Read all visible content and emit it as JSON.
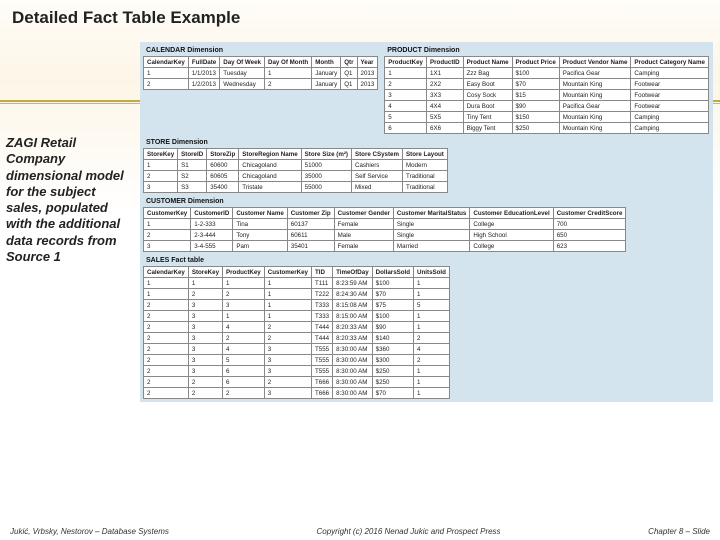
{
  "title": "Detailed Fact Table Example",
  "sidebar": "ZAGI Retail Company dimensional model for the subject sales, populated with the additional data records from Source 1",
  "calendar": {
    "title": "CALENDAR Dimension",
    "headers": [
      "CalendarKey",
      "FullDate",
      "Day Of Week",
      "Day Of Month",
      "Month",
      "Qtr",
      "Year"
    ],
    "rows": [
      [
        "1",
        "1/1/2013",
        "Tuesday",
        "1",
        "January",
        "Q1",
        "2013"
      ],
      [
        "2",
        "1/2/2013",
        "Wednesday",
        "2",
        "January",
        "Q1",
        "2013"
      ]
    ]
  },
  "product": {
    "title": "PRODUCT Dimension",
    "headers": [
      "ProductKey",
      "ProductID",
      "Product Name",
      "Product Price",
      "Product Vendor Name",
      "Product Category Name"
    ],
    "rows": [
      [
        "1",
        "1X1",
        "Zzz Bag",
        "$100",
        "Pacifica Gear",
        "Camping"
      ],
      [
        "2",
        "2X2",
        "Easy Boot",
        "$70",
        "Mountain King",
        "Footwear"
      ],
      [
        "3",
        "3X3",
        "Cosy Sock",
        "$15",
        "Mountain King",
        "Footwear"
      ],
      [
        "4",
        "4X4",
        "Dura Boot",
        "$90",
        "Pacifica Gear",
        "Footwear"
      ],
      [
        "5",
        "5X5",
        "Tiny Tent",
        "$150",
        "Mountain King",
        "Camping"
      ],
      [
        "6",
        "6X6",
        "Biggy Tent",
        "$250",
        "Mountain King",
        "Camping"
      ]
    ]
  },
  "store": {
    "title": "STORE Dimension",
    "headers": [
      "StoreKey",
      "StoreID",
      "StoreZip",
      "StoreRegion Name",
      "Store Size (m²)",
      "Store CSystem",
      "Store Layout"
    ],
    "rows": [
      [
        "1",
        "S1",
        "60600",
        "Chicagoland",
        "51000",
        "Cashiers",
        "Modern"
      ],
      [
        "2",
        "S2",
        "60605",
        "Chicagoland",
        "35000",
        "Self Service",
        "Traditional"
      ],
      [
        "3",
        "S3",
        "35400",
        "Tristate",
        "55000",
        "Mixed",
        "Traditional"
      ]
    ]
  },
  "customer": {
    "title": "CUSTOMER Dimension",
    "headers": [
      "CustomerKey",
      "CustomerID",
      "Customer Name",
      "Customer Zip",
      "Customer Gender",
      "Customer MaritalStatus",
      "Customer EducationLevel",
      "Customer CreditScore"
    ],
    "rows": [
      [
        "1",
        "1-2-333",
        "Tina",
        "60137",
        "Female",
        "Single",
        "College",
        "700"
      ],
      [
        "2",
        "2-3-444",
        "Tony",
        "60611",
        "Male",
        "Single",
        "High School",
        "650"
      ],
      [
        "3",
        "3-4-555",
        "Pam",
        "35401",
        "Female",
        "Married",
        "College",
        "623"
      ]
    ]
  },
  "sales": {
    "title": "SALES Fact table",
    "headers": [
      "CalendarKey",
      "StoreKey",
      "ProductKey",
      "CustomerKey",
      "TID",
      "TimeOfDay",
      "DollarsSold",
      "UnitsSold"
    ],
    "rows": [
      [
        "1",
        "1",
        "1",
        "1",
        "T111",
        "8:23:59 AM",
        "$100",
        "1"
      ],
      [
        "1",
        "2",
        "2",
        "1",
        "T222",
        "8:24:30 AM",
        "$70",
        "1"
      ],
      [
        "2",
        "3",
        "3",
        "1",
        "T333",
        "8:15:08 AM",
        "$75",
        "5"
      ],
      [
        "2",
        "3",
        "1",
        "1",
        "T333",
        "8:15:00 AM",
        "$100",
        "1"
      ],
      [
        "2",
        "3",
        "4",
        "2",
        "T444",
        "8:20:33 AM",
        "$90",
        "1"
      ],
      [
        "2",
        "3",
        "2",
        "2",
        "T444",
        "8:20:33 AM",
        "$140",
        "2"
      ],
      [
        "2",
        "3",
        "4",
        "3",
        "T555",
        "8:30:00 AM",
        "$360",
        "4"
      ],
      [
        "2",
        "3",
        "5",
        "3",
        "T555",
        "8:30:00 AM",
        "$300",
        "2"
      ],
      [
        "2",
        "3",
        "6",
        "3",
        "T555",
        "8:30:00 AM",
        "$250",
        "1"
      ],
      [
        "2",
        "2",
        "6",
        "2",
        "T666",
        "8:30:00 AM",
        "$250",
        "1"
      ],
      [
        "2",
        "2",
        "2",
        "3",
        "T666",
        "8:30:00 AM",
        "$70",
        "1"
      ]
    ]
  },
  "footer": {
    "left": "Jukić, Vrbsky, Nestorov – Database Systems",
    "center": "Copyright (c) 2016 Nenad Jukic and Prospect Press",
    "right": "Chapter 8 – Slide"
  }
}
